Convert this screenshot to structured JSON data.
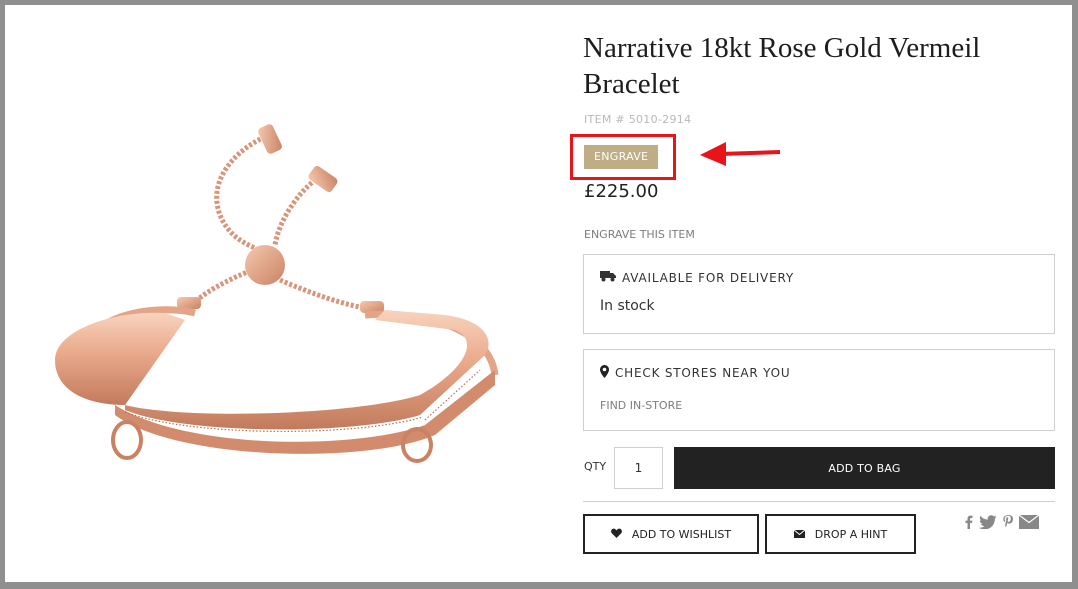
{
  "product": {
    "title": "Narrative 18kt Rose Gold Vermeil Bracelet",
    "item_number": "ITEM # 5010-2914",
    "engrave_label": "ENGRAVE",
    "price": "£225.00",
    "engrave_link": "ENGRAVE THIS ITEM"
  },
  "delivery": {
    "heading": "AVAILABLE FOR DELIVERY",
    "status": "In stock"
  },
  "stores": {
    "heading": "CHECK STORES NEAR YOU",
    "link": "FIND IN-STORE"
  },
  "purchase": {
    "qty_label": "QTY",
    "qty_value": "1",
    "add_to_bag": "ADD TO BAG"
  },
  "actions": {
    "wishlist": "ADD TO WISHLIST",
    "hint": "DROP A HINT"
  },
  "social_icons": [
    "facebook-icon",
    "twitter-icon",
    "pinterest-icon",
    "email-icon"
  ],
  "colors": {
    "engrave_bg": "#bfae85",
    "annotation_red": "#e8141a",
    "primary_dark": "#222222"
  }
}
